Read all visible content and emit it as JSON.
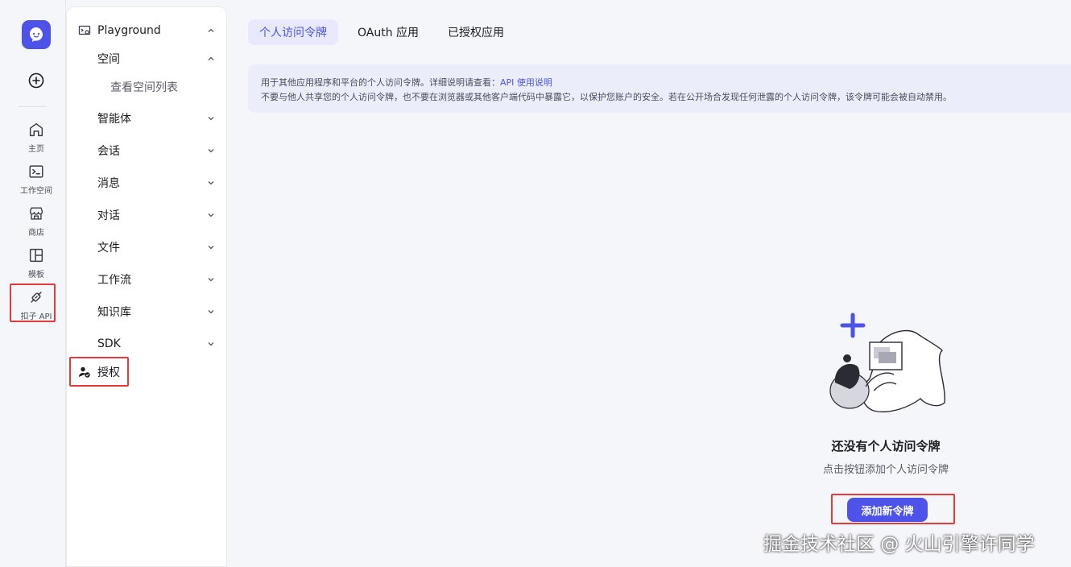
{
  "rail": {
    "items": [
      {
        "label": "主页"
      },
      {
        "label": "工作空间"
      },
      {
        "label": "商店"
      },
      {
        "label": "模板"
      },
      {
        "label": "扣子 API"
      }
    ]
  },
  "sidebar": {
    "playground": "Playground",
    "space": "空间",
    "space_list": "查看空间列表",
    "items": [
      "智能体",
      "会话",
      "消息",
      "对话",
      "文件",
      "工作流",
      "知识库",
      "SDK"
    ],
    "auth": "授权"
  },
  "tabs": [
    "个人访问令牌",
    "OAuth 应用",
    "已授权应用"
  ],
  "notice": {
    "line1": "用于其他应用程序和平台的个人访问令牌。详细说明请查看：",
    "link": "API 使用说明",
    "line2": "不要与他人共享您的个人访问令牌，也不要在浏览器或其他客户端代码中暴露它，以保护您账户的安全。若在公开场合发现任何泄露的个人访问令牌，该令牌可能会被自动禁用。"
  },
  "empty": {
    "title": "还没有个人访问令牌",
    "subtitle": "点击按钮添加个人访问令牌",
    "button": "添加新令牌"
  },
  "watermark": "掘金技术社区 @ 火山引擎许同学",
  "colors": {
    "accent": "#4d53e8",
    "highlight": "#e53a3a"
  }
}
